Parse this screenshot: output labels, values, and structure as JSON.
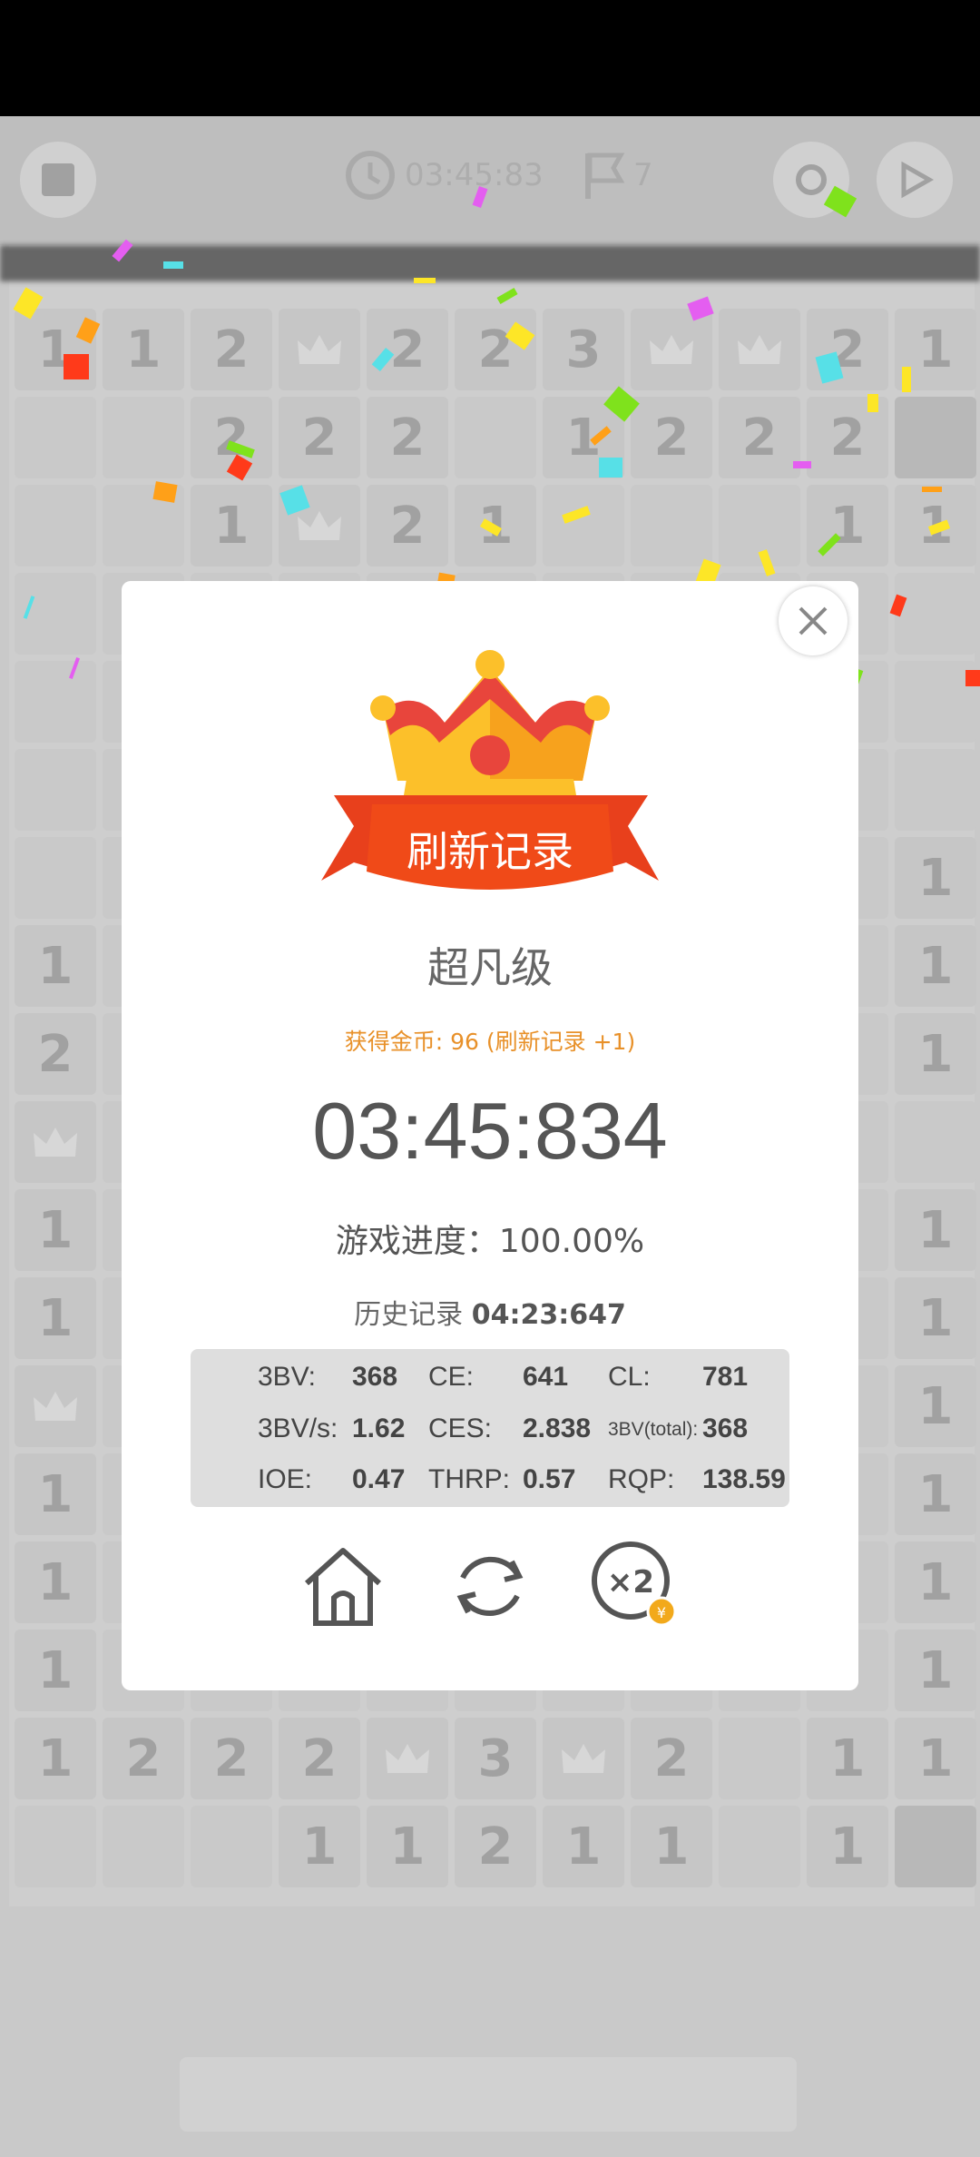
{
  "topbar": {
    "timer": "03:45:83",
    "flags": "7"
  },
  "board": {
    "rows": [
      [
        "1",
        "1",
        "2",
        "crown",
        "2",
        "2",
        "3",
        "crown",
        "crown",
        "2",
        "1"
      ],
      [
        "",
        "",
        "2",
        "2",
        "2",
        "",
        "1",
        "2",
        "2",
        "2",
        "#"
      ],
      [
        "",
        "",
        "1",
        "crown",
        "2",
        "1",
        "",
        "",
        "",
        "1",
        "1"
      ],
      [
        "",
        "",
        "",
        "",
        "",
        "",
        "",
        "",
        "",
        "",
        ""
      ],
      [
        "",
        "",
        "",
        "",
        "",
        "",
        "",
        "",
        "",
        "",
        ""
      ],
      [
        "",
        "",
        "",
        "",
        "",
        "",
        "",
        "",
        "",
        "",
        ""
      ],
      [
        "",
        "",
        "",
        "",
        "",
        "",
        "",
        "",
        "",
        "",
        "1"
      ],
      [
        "1",
        "",
        "",
        "",
        "",
        "",
        "",
        "",
        "",
        "",
        "1"
      ],
      [
        "2",
        "",
        "",
        "",
        "",
        "",
        "",
        "",
        "",
        "",
        "1"
      ],
      [
        "crown",
        "",
        "",
        "",
        "",
        "",
        "",
        "",
        "",
        "",
        ""
      ],
      [
        "1",
        "",
        "",
        "",
        "",
        "",
        "",
        "",
        "",
        "",
        "1"
      ],
      [
        "1",
        "",
        "",
        "",
        "",
        "",
        "",
        "",
        "",
        "",
        "1"
      ],
      [
        "crown",
        "",
        "",
        "",
        "",
        "",
        "",
        "",
        "",
        "",
        "1"
      ],
      [
        "1",
        "",
        "",
        "",
        "",
        "",
        "",
        "",
        "",
        "",
        "1"
      ],
      [
        "1",
        "",
        "",
        "",
        "",
        "",
        "",
        "",
        "",
        "",
        "1"
      ],
      [
        "1",
        "",
        "",
        "",
        "",
        "",
        "",
        "",
        "",
        "",
        "1"
      ],
      [
        "1",
        "2",
        "2",
        "2",
        "crown",
        "3",
        "crown",
        "2",
        "",
        "1",
        "1"
      ],
      [
        "",
        "",
        "",
        "1",
        "1",
        "2",
        "1",
        "1",
        "",
        "1",
        "#"
      ]
    ]
  },
  "modal": {
    "banner": "刷新记录",
    "level": "超凡级",
    "coins": "获得金币: 96 (刷新记录 +1)",
    "time": "03:45:834",
    "progress": "游戏进度：100.00%",
    "history_label": "历史记录",
    "history_value": "04:23:647",
    "stats": {
      "bv_label": "3BV:",
      "bv": "368",
      "ce_label": "CE:",
      "ce": "641",
      "cl_label": "CL:",
      "cl": "781",
      "bvs_label": "3BV/s:",
      "bvs": "1.62",
      "ces_label": "CES:",
      "ces": "2.838",
      "bvt_label": "3BV(total):",
      "bvt": "368",
      "ioe_label": "IOE:",
      "ioe": "0.47",
      "thrp_label": "THRP:",
      "thrp": "0.57",
      "rqp_label": "RQP:",
      "rqp": "138.59"
    },
    "double_icon_text": "×2"
  },
  "colors": {
    "accent": "#e8912a",
    "banner": "#e8401c",
    "crown_yellow": "#fcc02a",
    "crown_red": "#e8453c"
  }
}
